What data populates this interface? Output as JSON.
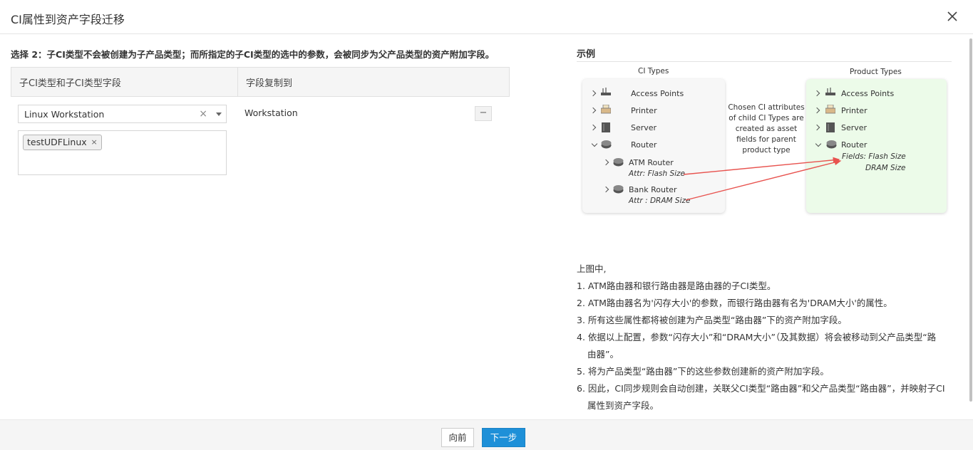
{
  "dialog": {
    "title": "CI属性到资产字段迁移",
    "close_icon": "close-icon"
  },
  "instruction": "选择 2：子CI类型不会被创建为子产品类型；而所指定的子CI类型的选中的参数，会被同步为父产品类型的资产附加字段。",
  "mapping": {
    "columns": [
      "子CI类型和子CI类型字段",
      "字段复制到"
    ],
    "rows": [
      {
        "ci_type": "Linux Workstation",
        "clear_symbol": "×",
        "fields": [
          {
            "label": "testUDFLinux",
            "remove_symbol": "×"
          }
        ],
        "copy_to": "Workstation",
        "remove_symbol": "−"
      }
    ]
  },
  "example": {
    "title": "示例",
    "diagram": {
      "left_heading": "CI Types",
      "right_heading": "Product Types",
      "left_items": [
        "Access Points",
        "Printer",
        "Server",
        "Router"
      ],
      "left_children": [
        {
          "label": "ATM Router",
          "attr": "Attr: Flash Size"
        },
        {
          "label": "Bank Router",
          "attr": "Attr : DRAM Size"
        }
      ],
      "middle_text": "Chosen CI attributes of child CI Types are created as asset fields for parent product type",
      "right_items": [
        "Access Points",
        "Printer",
        "Server",
        "Router"
      ],
      "right_fields_line1": "Fields: Flash Size",
      "right_fields_line2": "DRAM Size",
      "arrow_color": "#e8534f",
      "left_panel_color": "#f7f7f7",
      "right_panel_color": "#ecfbe9"
    },
    "notes": {
      "intro": "上图中,",
      "items": [
        "1. ATM路由器和银行路由器是路由器的子CI类型。",
        "2. ATM路由器名为'闪存大小'的参数，而银行路由器有名为'DRAM大小'的属性。",
        "3. 所有这些属性都将被创建为产品类型“路由器”下的资产附加字段。",
        "4. 依据以上配置，参数“闪存大小”和“DRAM大小”（及其数据）将会被移动到父产品类型“路",
        "由器”。",
        "5. 将为产品类型“路由器”下的这些参数创建新的资产附加字段。",
        "6. 因此，CI同步规则会自动创建，关联父CI类型“路由器”和父产品类型“路由器”，并映射子CI",
        "属性到资产字段。"
      ]
    }
  },
  "footer": {
    "prev_label": "向前",
    "next_label": "下一步",
    "next_color": "#1e90d8"
  }
}
